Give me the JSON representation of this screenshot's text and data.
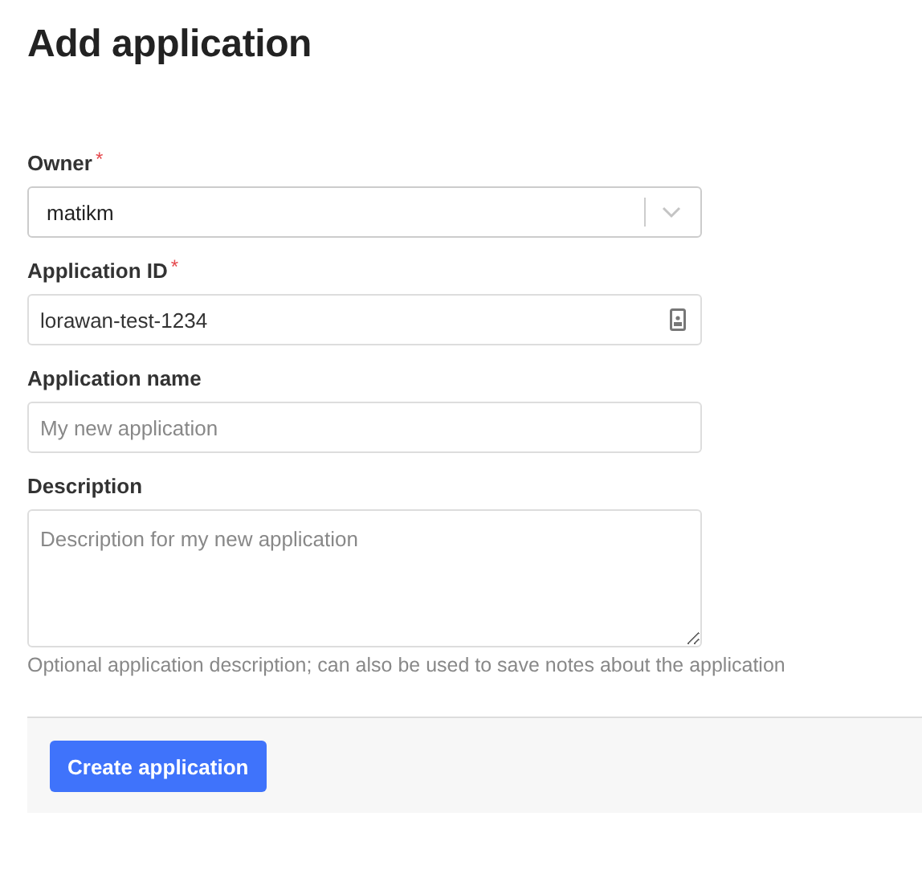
{
  "title": "Add application",
  "fields": [
    {
      "kind": "select",
      "label": "Owner",
      "required_mark": "*",
      "value": "matikm"
    },
    {
      "kind": "id-input",
      "label": "Application ID",
      "required_mark": "*",
      "value": "lorawan-test-1234"
    },
    {
      "kind": "input",
      "label": "Application name",
      "placeholder": "My new application"
    },
    {
      "kind": "textarea",
      "label": "Description",
      "placeholder": "Description for my new application",
      "hint": "Optional application description; can also be used to save notes about the application"
    }
  ],
  "submit": "Create application"
}
